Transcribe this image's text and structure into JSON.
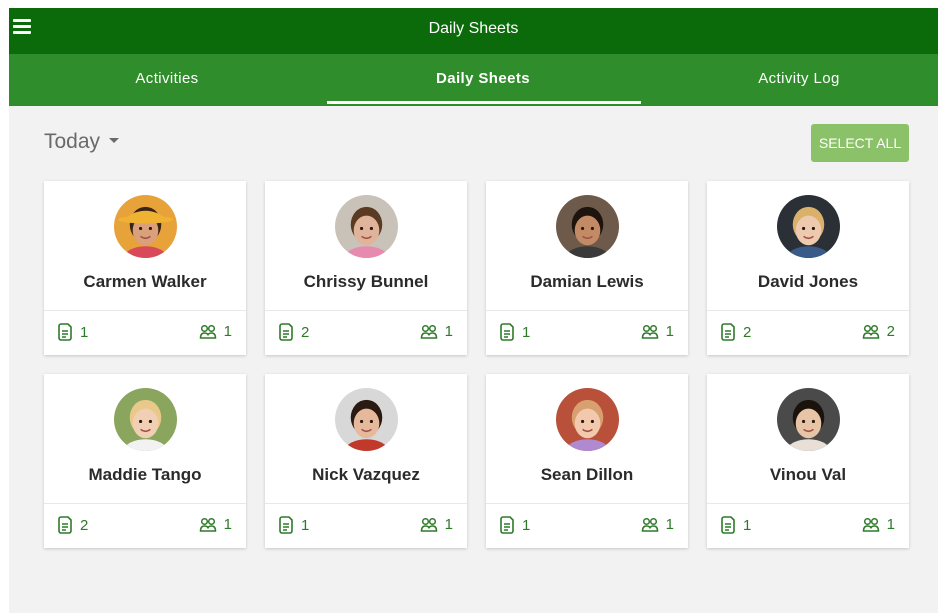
{
  "app": {
    "title": "Daily Sheets"
  },
  "tabs": [
    {
      "label": "Activities"
    },
    {
      "label": "Daily Sheets",
      "active": true
    },
    {
      "label": "Activity Log"
    }
  ],
  "filter": {
    "date_label": "Today"
  },
  "actions": {
    "select_all_label": "SELECT ALL"
  },
  "icons": {
    "sheets": "document-icon",
    "activities": "group-icon"
  },
  "colors": {
    "titlebar": "#0b6b0b",
    "tabbar": "#2f8d2b",
    "accent_button": "#8bc169",
    "stat_text": "#2f7a2a"
  },
  "children": [
    {
      "name": "Carmen Walker",
      "sheets": "1",
      "activities": "1"
    },
    {
      "name": "Chrissy Bunnel",
      "sheets": "2",
      "activities": "1"
    },
    {
      "name": "Damian Lewis",
      "sheets": "1",
      "activities": "1"
    },
    {
      "name": "David Jones",
      "sheets": "2",
      "activities": "2"
    },
    {
      "name": "Maddie Tango",
      "sheets": "2",
      "activities": "1"
    },
    {
      "name": "Nick Vazquez",
      "sheets": "1",
      "activities": "1"
    },
    {
      "name": "Sean Dillon",
      "sheets": "1",
      "activities": "1"
    },
    {
      "name": "Vinou Val",
      "sheets": "1",
      "activities": "1"
    }
  ]
}
